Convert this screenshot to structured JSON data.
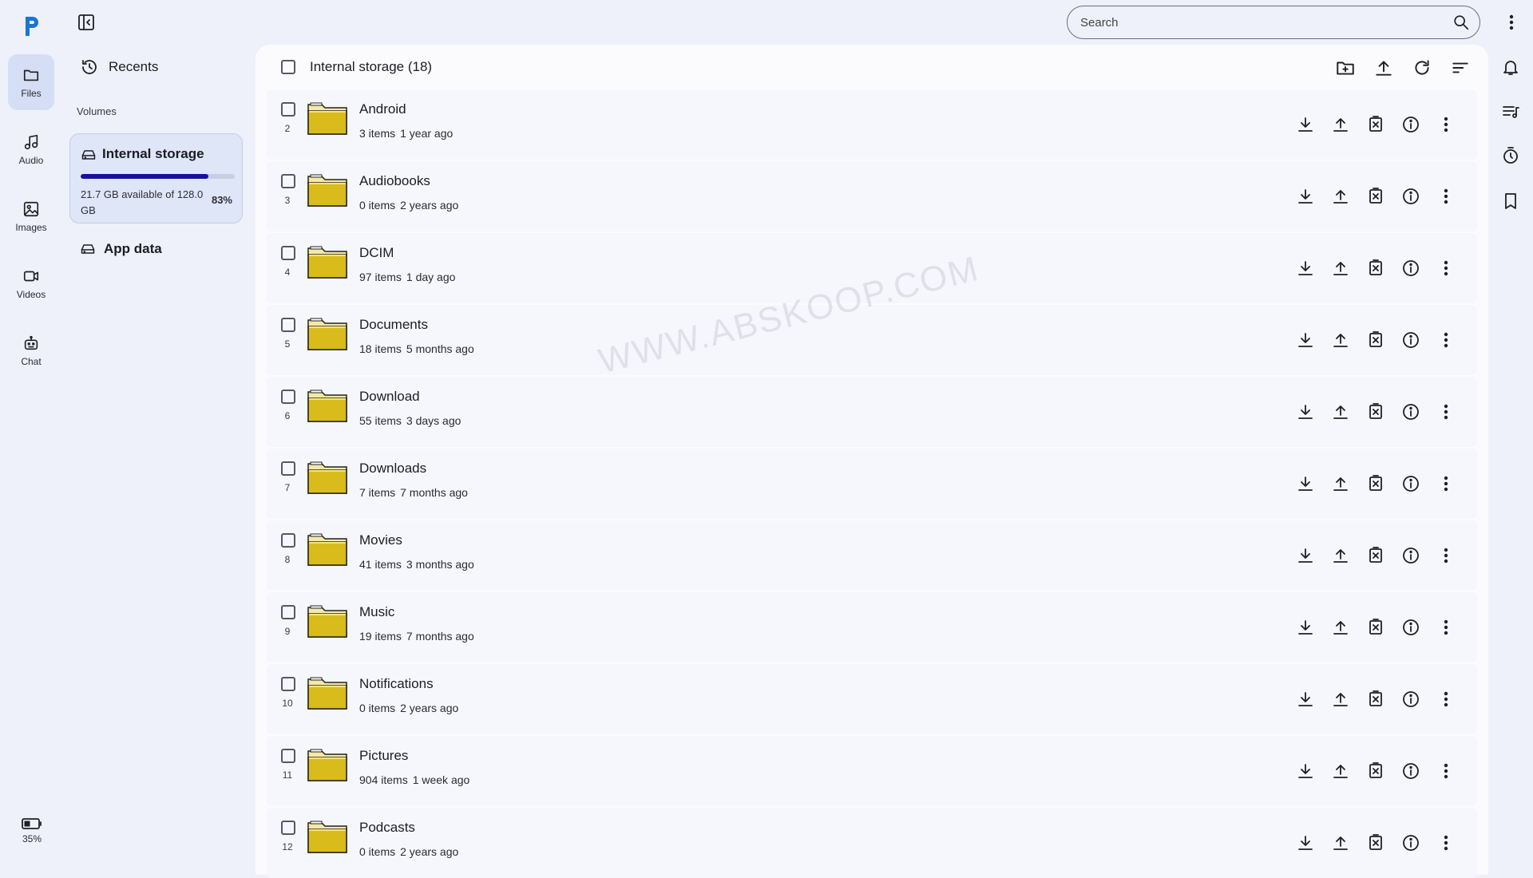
{
  "rail": {
    "items": [
      {
        "label": "Files",
        "icon": "folder-icon",
        "active": true
      },
      {
        "label": "Audio",
        "icon": "music-note-icon",
        "active": false
      },
      {
        "label": "Images",
        "icon": "image-icon",
        "active": false
      },
      {
        "label": "Videos",
        "icon": "video-icon",
        "active": false
      },
      {
        "label": "Chat",
        "icon": "robot-icon",
        "active": false
      }
    ],
    "battery": "35%"
  },
  "side": {
    "recents": "Recents",
    "volumes_title": "Volumes",
    "internal": {
      "name": "Internal storage",
      "available": "21.7 GB available of 128.0 GB",
      "percent": "83%",
      "used_fraction": 0.83
    },
    "app_data": "App data"
  },
  "search": {
    "placeholder": "Search",
    "value": ""
  },
  "header": {
    "title": "Internal storage (18)"
  },
  "files": [
    {
      "index": "2",
      "name": "Android",
      "count": "3 items",
      "time": "1 year ago"
    },
    {
      "index": "3",
      "name": "Audiobooks",
      "count": "0 items",
      "time": "2 years ago"
    },
    {
      "index": "4",
      "name": "DCIM",
      "count": "97 items",
      "time": "1 day ago"
    },
    {
      "index": "5",
      "name": "Documents",
      "count": "18 items",
      "time": "5 months ago"
    },
    {
      "index": "6",
      "name": "Download",
      "count": "55 items",
      "time": "3 days ago"
    },
    {
      "index": "7",
      "name": "Downloads",
      "count": "7 items",
      "time": "7 months ago"
    },
    {
      "index": "8",
      "name": "Movies",
      "count": "41 items",
      "time": "3 months ago"
    },
    {
      "index": "9",
      "name": "Music",
      "count": "19 items",
      "time": "7 months ago"
    },
    {
      "index": "10",
      "name": "Notifications",
      "count": "0 items",
      "time": "2 years ago"
    },
    {
      "index": "11",
      "name": "Pictures",
      "count": "904 items",
      "time": "1 week ago"
    },
    {
      "index": "12",
      "name": "Podcasts",
      "count": "0 items",
      "time": "2 years ago"
    }
  ],
  "watermark": "WWW.ABSKOOP.COM",
  "colors": {
    "accent": "#16119a",
    "logo": "#1976d2",
    "folder": "#d9bc1c",
    "active_nav": "#d6def5"
  }
}
